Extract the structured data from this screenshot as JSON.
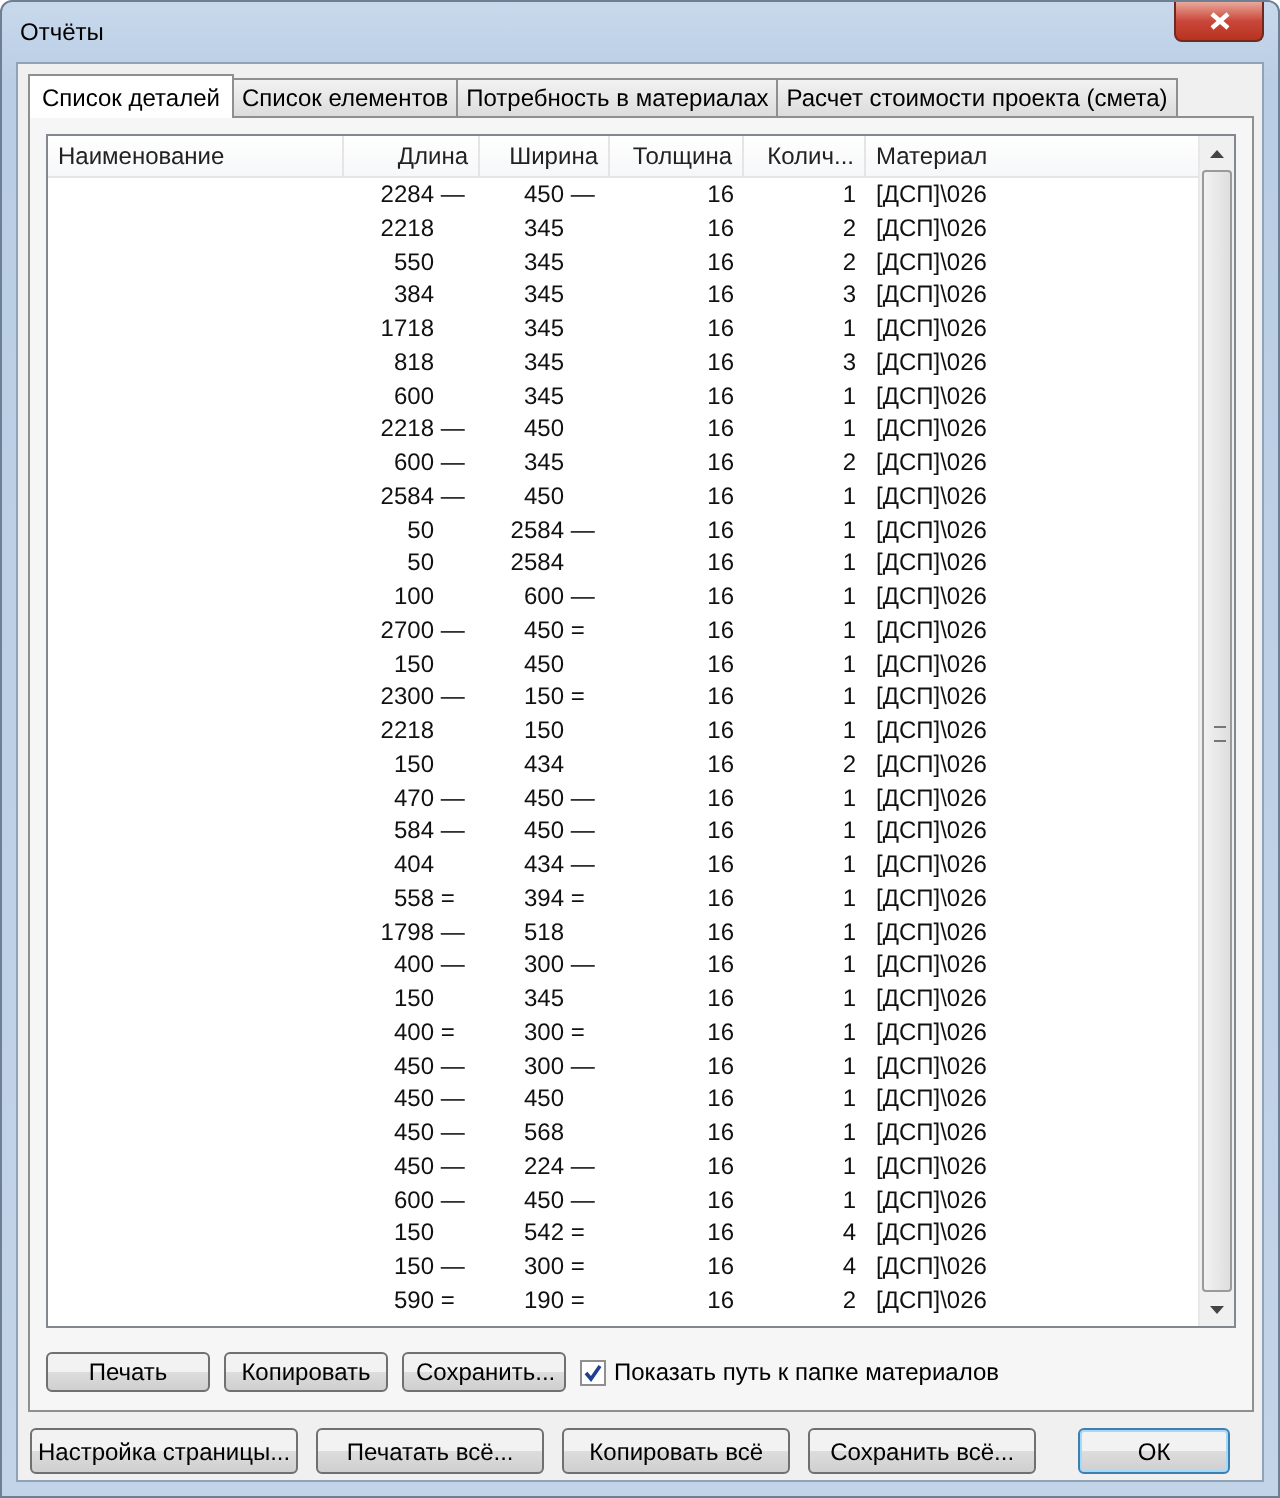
{
  "window": {
    "title": "Отчёты"
  },
  "tabs": [
    {
      "label": "Список деталей",
      "selected": true
    },
    {
      "label": "Список елементов",
      "selected": false
    },
    {
      "label": "Потребность в материалах",
      "selected": false
    },
    {
      "label": "Расчет стоимости проекта (смета)",
      "selected": false
    }
  ],
  "table": {
    "columns": [
      "Наименование",
      "Длина",
      "Ширина",
      "Толщина",
      "Колич...",
      "Материал"
    ],
    "rows": [
      [
        [
          ""
        ],
        [
          "2284",
          "—"
        ],
        [
          "450",
          "—"
        ],
        [
          "16"
        ],
        [
          "1"
        ],
        [
          "[ДСП]\\026"
        ]
      ],
      [
        [
          ""
        ],
        [
          "2218"
        ],
        [
          "345"
        ],
        [
          "16"
        ],
        [
          "2"
        ],
        [
          "[ДСП]\\026"
        ]
      ],
      [
        [
          ""
        ],
        [
          "550"
        ],
        [
          "345"
        ],
        [
          "16"
        ],
        [
          "2"
        ],
        [
          "[ДСП]\\026"
        ]
      ],
      [
        [
          ""
        ],
        [
          "384"
        ],
        [
          "345"
        ],
        [
          "16"
        ],
        [
          "3"
        ],
        [
          "[ДСП]\\026"
        ]
      ],
      [
        [
          ""
        ],
        [
          "1718"
        ],
        [
          "345"
        ],
        [
          "16"
        ],
        [
          "1"
        ],
        [
          "[ДСП]\\026"
        ]
      ],
      [
        [
          ""
        ],
        [
          "818"
        ],
        [
          "345"
        ],
        [
          "16"
        ],
        [
          "3"
        ],
        [
          "[ДСП]\\026"
        ]
      ],
      [
        [
          ""
        ],
        [
          "600"
        ],
        [
          "345"
        ],
        [
          "16"
        ],
        [
          "1"
        ],
        [
          "[ДСП]\\026"
        ]
      ],
      [
        [
          ""
        ],
        [
          "2218",
          "—"
        ],
        [
          "450"
        ],
        [
          "16"
        ],
        [
          "1"
        ],
        [
          "[ДСП]\\026"
        ]
      ],
      [
        [
          ""
        ],
        [
          "600",
          "—"
        ],
        [
          "345"
        ],
        [
          "16"
        ],
        [
          "2"
        ],
        [
          "[ДСП]\\026"
        ]
      ],
      [
        [
          ""
        ],
        [
          "2584",
          "—"
        ],
        [
          "450"
        ],
        [
          "16"
        ],
        [
          "1"
        ],
        [
          "[ДСП]\\026"
        ]
      ],
      [
        [
          ""
        ],
        [
          "50"
        ],
        [
          "2584",
          "—"
        ],
        [
          "16"
        ],
        [
          "1"
        ],
        [
          "[ДСП]\\026"
        ]
      ],
      [
        [
          ""
        ],
        [
          "50"
        ],
        [
          "2584"
        ],
        [
          "16"
        ],
        [
          "1"
        ],
        [
          "[ДСП]\\026"
        ]
      ],
      [
        [
          ""
        ],
        [
          "100"
        ],
        [
          "600",
          "—"
        ],
        [
          "16"
        ],
        [
          "1"
        ],
        [
          "[ДСП]\\026"
        ]
      ],
      [
        [
          ""
        ],
        [
          "2700",
          "—"
        ],
        [
          "450",
          "="
        ],
        [
          "16"
        ],
        [
          "1"
        ],
        [
          "[ДСП]\\026"
        ]
      ],
      [
        [
          ""
        ],
        [
          "150"
        ],
        [
          "450"
        ],
        [
          "16"
        ],
        [
          "1"
        ],
        [
          "[ДСП]\\026"
        ]
      ],
      [
        [
          ""
        ],
        [
          "2300",
          "—"
        ],
        [
          "150",
          "="
        ],
        [
          "16"
        ],
        [
          "1"
        ],
        [
          "[ДСП]\\026"
        ]
      ],
      [
        [
          ""
        ],
        [
          "2218"
        ],
        [
          "150"
        ],
        [
          "16"
        ],
        [
          "1"
        ],
        [
          "[ДСП]\\026"
        ]
      ],
      [
        [
          ""
        ],
        [
          "150"
        ],
        [
          "434"
        ],
        [
          "16"
        ],
        [
          "2"
        ],
        [
          "[ДСП]\\026"
        ]
      ],
      [
        [
          ""
        ],
        [
          "470",
          "—"
        ],
        [
          "450",
          "—"
        ],
        [
          "16"
        ],
        [
          "1"
        ],
        [
          "[ДСП]\\026"
        ]
      ],
      [
        [
          ""
        ],
        [
          "584",
          "—"
        ],
        [
          "450",
          "—"
        ],
        [
          "16"
        ],
        [
          "1"
        ],
        [
          "[ДСП]\\026"
        ]
      ],
      [
        [
          ""
        ],
        [
          "404"
        ],
        [
          "434",
          "—"
        ],
        [
          "16"
        ],
        [
          "1"
        ],
        [
          "[ДСП]\\026"
        ]
      ],
      [
        [
          ""
        ],
        [
          "558",
          "="
        ],
        [
          "394",
          "="
        ],
        [
          "16"
        ],
        [
          "1"
        ],
        [
          "[ДСП]\\026"
        ]
      ],
      [
        [
          ""
        ],
        [
          "1798",
          "—"
        ],
        [
          "518"
        ],
        [
          "16"
        ],
        [
          "1"
        ],
        [
          "[ДСП]\\026"
        ]
      ],
      [
        [
          ""
        ],
        [
          "400",
          "—"
        ],
        [
          "300",
          "—"
        ],
        [
          "16"
        ],
        [
          "1"
        ],
        [
          "[ДСП]\\026"
        ]
      ],
      [
        [
          ""
        ],
        [
          "150"
        ],
        [
          "345"
        ],
        [
          "16"
        ],
        [
          "1"
        ],
        [
          "[ДСП]\\026"
        ]
      ],
      [
        [
          ""
        ],
        [
          "400",
          "="
        ],
        [
          "300",
          "="
        ],
        [
          "16"
        ],
        [
          "1"
        ],
        [
          "[ДСП]\\026"
        ]
      ],
      [
        [
          ""
        ],
        [
          "450",
          "—"
        ],
        [
          "300",
          "—"
        ],
        [
          "16"
        ],
        [
          "1"
        ],
        [
          "[ДСП]\\026"
        ]
      ],
      [
        [
          ""
        ],
        [
          "450",
          "—"
        ],
        [
          "450"
        ],
        [
          "16"
        ],
        [
          "1"
        ],
        [
          "[ДСП]\\026"
        ]
      ],
      [
        [
          ""
        ],
        [
          "450",
          "—"
        ],
        [
          "568"
        ],
        [
          "16"
        ],
        [
          "1"
        ],
        [
          "[ДСП]\\026"
        ]
      ],
      [
        [
          ""
        ],
        [
          "450",
          "—"
        ],
        [
          "224",
          "—"
        ],
        [
          "16"
        ],
        [
          "1"
        ],
        [
          "[ДСП]\\026"
        ]
      ],
      [
        [
          ""
        ],
        [
          "600",
          "—"
        ],
        [
          "450",
          "—"
        ],
        [
          "16"
        ],
        [
          "1"
        ],
        [
          "[ДСП]\\026"
        ]
      ],
      [
        [
          ""
        ],
        [
          "150"
        ],
        [
          "542",
          "="
        ],
        [
          "16"
        ],
        [
          "4"
        ],
        [
          "[ДСП]\\026"
        ]
      ],
      [
        [
          ""
        ],
        [
          "150",
          "—"
        ],
        [
          "300",
          "="
        ],
        [
          "16"
        ],
        [
          "4"
        ],
        [
          "[ДСП]\\026"
        ]
      ],
      [
        [
          ""
        ],
        [
          "590",
          "="
        ],
        [
          "190",
          "="
        ],
        [
          "16"
        ],
        [
          "2"
        ],
        [
          "[ДСП]\\026"
        ]
      ]
    ]
  },
  "panel_buttons": [
    "Печать",
    "Копировать",
    "Сохранить..."
  ],
  "show_path": {
    "label": "Показать путь к папке материалов",
    "checked": true
  },
  "dialog_buttons": [
    "Настройка страницы...",
    "Печатать всё...",
    "Копировать всё",
    "Сохранить всё...",
    "ОК"
  ]
}
